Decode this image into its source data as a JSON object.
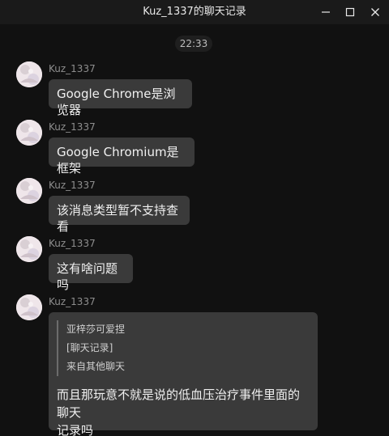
{
  "window": {
    "title": "Kuz_1337的聊天记录",
    "minimize_icon": "minimize-icon",
    "maximize_icon": "maximize-icon",
    "close_icon": "close-icon"
  },
  "chat": {
    "time": "22:33",
    "messages": [
      {
        "sender": "Kuz_1337",
        "text": "Google Chrome是浏览器"
      },
      {
        "sender": "Kuz_1337",
        "text": "Google Chromium是框架"
      },
      {
        "sender": "Kuz_1337",
        "text": "该消息类型暂不支持查看"
      },
      {
        "sender": "Kuz_1337",
        "text": "这有啥问题吗"
      },
      {
        "sender": "Kuz_1337",
        "quote": {
          "author": "亚梓莎可爱捏",
          "content": "[聊天记录]",
          "source": "来自其他聊天"
        },
        "text_line1": "而且那玩意不就是说的低血压治疗事件里面的聊天",
        "text_line2": "记录吗"
      }
    ]
  },
  "colors": {
    "background": "#111111",
    "bubble": "#3a3a3a",
    "text": "#f0f0f0",
    "secondary_text": "#8e8e8e"
  }
}
